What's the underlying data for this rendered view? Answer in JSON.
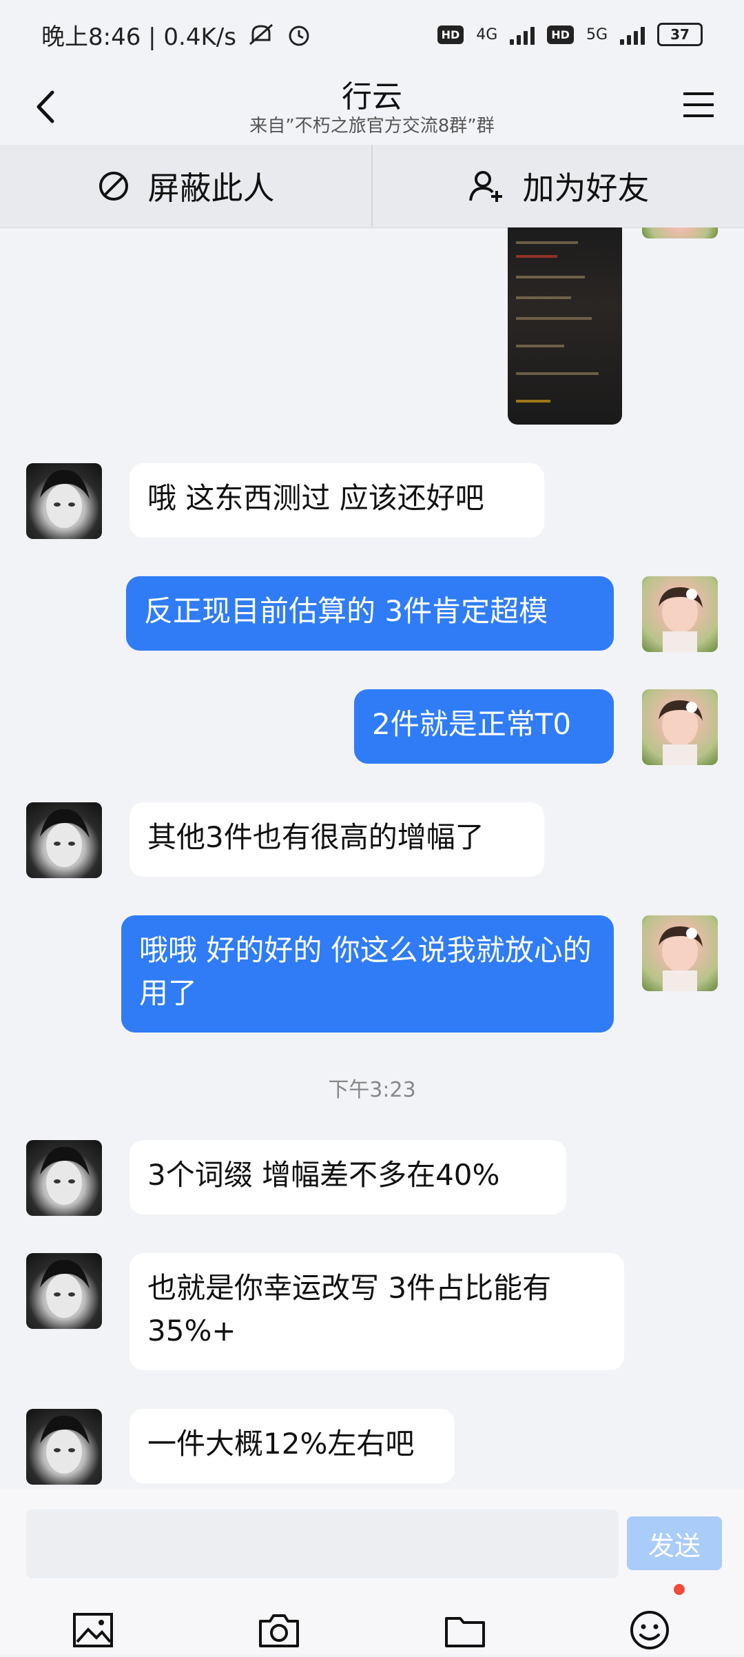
{
  "status_bar": {
    "time_and_speed": "晚上8:46 | 0.4K/s",
    "network_1": "4G",
    "network_2": "5G",
    "hd": "HD",
    "battery": "37"
  },
  "header": {
    "title": "行云",
    "subtitle": "来自”不朽之旅官方交流8群”群"
  },
  "actions": {
    "block_label": "屏蔽此人",
    "add_friend_label": "加为好友"
  },
  "messages": [
    {
      "side": "left",
      "text": "哦 这东西测过 应该还好吧"
    },
    {
      "side": "right",
      "text": "反正现目前估算的 3件肯定超模"
    },
    {
      "side": "right",
      "text": "2件就是正常T0"
    },
    {
      "side": "left",
      "text": "其他3件也有很高的增幅了"
    },
    {
      "side": "right",
      "text": "哦哦 好的好的 你这么说我就放心的用了"
    },
    {
      "side": "left",
      "text": "3个词缀  增幅差不多在40%"
    },
    {
      "side": "left",
      "text": "也就是你幸运改写  3件占比能有35%+"
    },
    {
      "side": "left",
      "text": "一件大概12%左右吧"
    }
  ],
  "time_separator": "下午3:23",
  "input": {
    "placeholder": "",
    "send_label": "发送"
  },
  "icons": {
    "back": "chevron-left-icon",
    "menu": "menu-icon",
    "block": "block-icon",
    "add_friend": "add-user-icon",
    "image": "image-icon",
    "camera": "camera-icon",
    "folder": "folder-icon",
    "emoji": "emoji-icon"
  },
  "colors": {
    "bubble_self": "#2f7cf6",
    "bubble_other": "#ffffff",
    "background": "#f2f3f7",
    "send_disabled": "#a9ccf8"
  }
}
